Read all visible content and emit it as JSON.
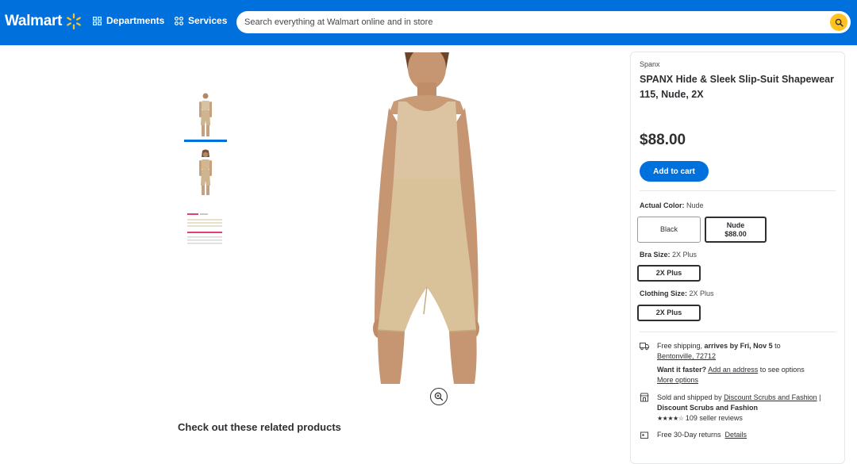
{
  "header": {
    "logo_text": "Walmart",
    "departments_label": "Departments",
    "services_label": "Services",
    "search_placeholder": "Search everything at Walmart online and in store",
    "brand_color": "#0071dc",
    "search_button_color": "#ffc220"
  },
  "gallery": {
    "thumbnails": [
      {
        "name": "front-view",
        "selected": true
      },
      {
        "name": "front-view-alt",
        "selected": false
      },
      {
        "name": "size-chart",
        "selected": false
      }
    ],
    "size_chart_caption": "Clothing Size Fit"
  },
  "related_heading": "Check out these related products",
  "product": {
    "brand": "Spanx",
    "title": "SPANX Hide & Sleek Slip-Suit Shapewear 115, Nude, 2X",
    "price": "$88.00",
    "add_to_cart_label": "Add to cart",
    "color_label": "Actual Color:",
    "color_value": "Nude",
    "colors": [
      {
        "name": "Black",
        "price": "",
        "selected": false
      },
      {
        "name": "Nude",
        "price": "$88.00",
        "selected": true
      }
    ],
    "bra_size_label": "Bra Size:",
    "bra_size_value": "2X Plus",
    "bra_size_option": "2X Plus",
    "clothing_size_label": "Clothing Size:",
    "clothing_size_value": "2X Plus",
    "clothing_size_option": "2X Plus"
  },
  "fulfillment": {
    "shipping_prefix": "Free shipping, ",
    "shipping_bold": "arrives by Fri, Nov 5",
    "shipping_to": " to",
    "location_link": "Bentonville, 72712",
    "faster_bold": "Want it faster?",
    "add_address_link": "Add an address",
    "see_options": " to see options",
    "more_options_link": "More options",
    "sold_prefix": "Sold and shipped by ",
    "seller_link": "Discount Scrubs and Fashion",
    "seller_sep": " |",
    "seller_bold": "Discount Scrubs and Fashion",
    "stars": "★★★★☆",
    "seller_reviews": "109 seller reviews",
    "returns_text": "Free 30-Day returns",
    "details_link": "Details"
  }
}
